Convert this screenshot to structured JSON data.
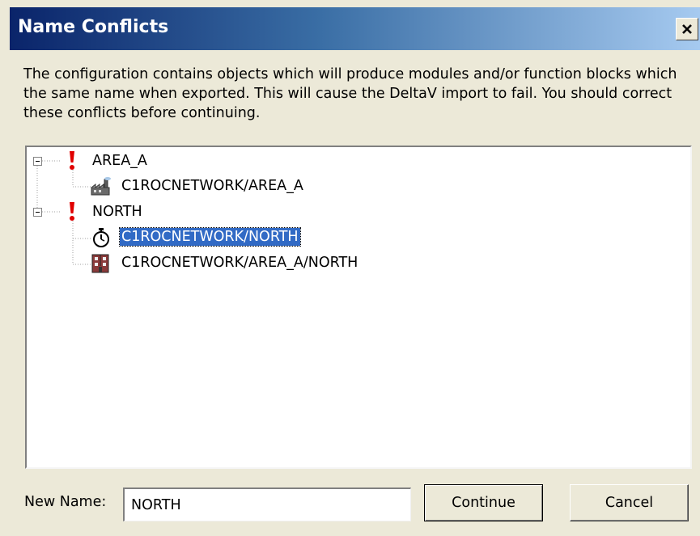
{
  "dialog": {
    "title": "Name Conflicts",
    "message": "The configuration contains objects which will produce modules and/or function blocks which the same name when exported.  This will cause the DeltaV import to fail.  You should correct these conflicts before continuing."
  },
  "tree": {
    "groups": [
      {
        "label": "AREA_A",
        "children": [
          {
            "label": "C1ROCNETWORK/AREA_A",
            "icon": "factory-icon"
          }
        ]
      },
      {
        "label": "NORTH",
        "children": [
          {
            "label": "C1ROCNETWORK/NORTH",
            "icon": "stopwatch-icon",
            "selected": true
          },
          {
            "label": "C1ROCNETWORK/AREA_A/NORTH",
            "icon": "building-icon"
          }
        ]
      }
    ]
  },
  "new_name": {
    "label": "New Name:",
    "value": "NORTH"
  },
  "buttons": {
    "continue": "Continue",
    "cancel": "Cancel"
  },
  "colors": {
    "selection": "#316ac5",
    "warning": "#e00000",
    "title_start": "#0a246a",
    "title_end": "#a6caf0"
  }
}
